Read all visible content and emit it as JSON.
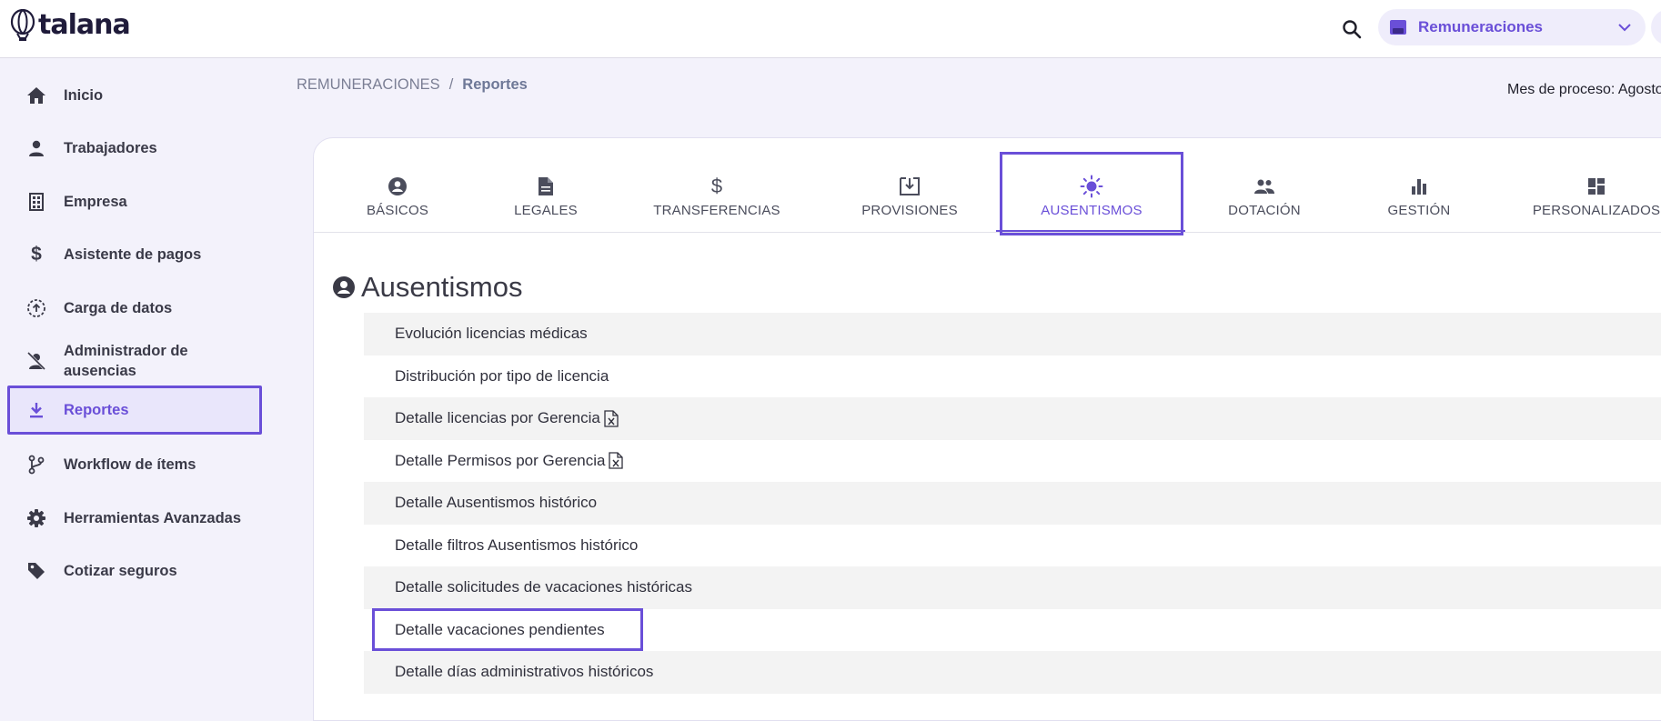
{
  "topbar": {
    "logo_text": "talana",
    "search_icon": "search-icon",
    "module_selector": {
      "label": "Remuneraciones",
      "icon": "payroll-card-icon",
      "chevron": "chevron-down-icon"
    }
  },
  "sidebar": {
    "items": [
      {
        "label": "Inicio",
        "icon": "home-icon",
        "active": false
      },
      {
        "label": "Trabajadores",
        "icon": "person-icon",
        "active": false
      },
      {
        "label": "Empresa",
        "icon": "building-icon",
        "active": false
      },
      {
        "label": "Asistente de pagos",
        "icon": "dollar-icon",
        "active": false
      },
      {
        "label": "Carga de datos",
        "icon": "upload-circle-icon",
        "active": false
      },
      {
        "label": "Administrador de ausencias",
        "icon": "person-off-icon",
        "active": false
      },
      {
        "label": "Reportes",
        "icon": "download-icon",
        "active": true
      },
      {
        "label": "Workflow de ítems",
        "icon": "workflow-icon",
        "active": false
      },
      {
        "label": "Herramientas Avanzadas",
        "icon": "gear-icon",
        "active": false
      },
      {
        "label": "Cotizar seguros",
        "icon": "tag-icon",
        "active": false
      }
    ]
  },
  "breadcrumb": {
    "root": "REMUNERACIONES",
    "separator": "/",
    "current": "Reportes"
  },
  "process_month": "Mes de proceso: Agosto",
  "tabs": [
    {
      "label": "BÁSICOS",
      "icon": "account-circle-icon",
      "active": false
    },
    {
      "label": "LEGALES",
      "icon": "document-icon",
      "active": false
    },
    {
      "label": "TRANSFERENCIAS",
      "icon": "dollar-icon",
      "active": false
    },
    {
      "label": "PROVISIONES",
      "icon": "download-box-icon",
      "active": false
    },
    {
      "label": "AUSENTISMOS",
      "icon": "sun-icon",
      "active": true
    },
    {
      "label": "DOTACIÓN",
      "icon": "people-icon",
      "active": false
    },
    {
      "label": "GESTIÓN",
      "icon": "bar-chart-icon",
      "active": false
    },
    {
      "label": "PERSONALIZADOS",
      "icon": "dashboard-icon",
      "active": false
    }
  ],
  "section": {
    "title": "Ausentismos",
    "icon": "account-circle-icon",
    "reports": [
      {
        "label": "Evolución licencias médicas",
        "excel": false
      },
      {
        "label": "Distribución por tipo de licencia",
        "excel": false
      },
      {
        "label": "Detalle licencias por Gerencia",
        "excel": true
      },
      {
        "label": "Detalle Permisos por Gerencia",
        "excel": true
      },
      {
        "label": "Detalle Ausentismos histórico",
        "excel": false
      },
      {
        "label": "Detalle filtros Ausentismos histórico",
        "excel": false
      },
      {
        "label": "Detalle solicitudes de vacaciones históricas",
        "excel": false
      },
      {
        "label": "Detalle vacaciones pendientes",
        "excel": false
      },
      {
        "label": "Detalle días administrativos históricos",
        "excel": false
      }
    ]
  },
  "colors": {
    "accent": "#6a4fd8",
    "sidebar_bg": "#f3f2fb",
    "row_alt": "#f3f3f3"
  }
}
